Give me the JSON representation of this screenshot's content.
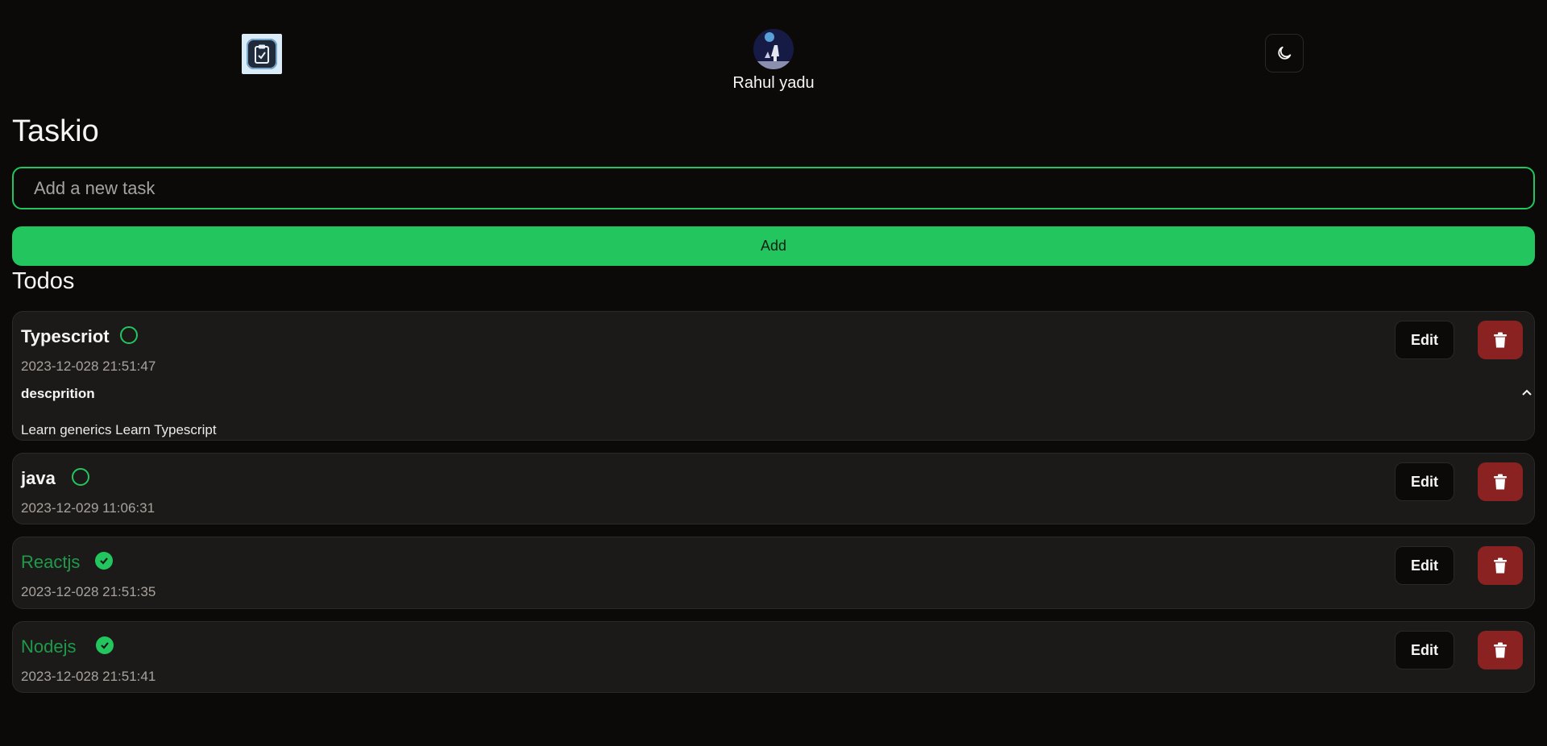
{
  "header": {
    "logo_icon": "clipboard-check-icon",
    "user_name": "Rahul yadu",
    "theme_icon": "moon-icon"
  },
  "app": {
    "title": "Taskio"
  },
  "new_task": {
    "placeholder": "Add a new task",
    "value": ""
  },
  "add_button": {
    "label": "Add"
  },
  "todos_heading": "Todos",
  "todo_labels": {
    "edit": "Edit",
    "delete_icon": "trash-icon"
  },
  "todos": [
    {
      "title": "Typescriot",
      "date": "2023-12-028 21:51:47",
      "completed": false,
      "expanded": true,
      "description_label": "descprition",
      "description": "Learn generics Learn Typescript"
    },
    {
      "title": "java",
      "date": "2023-12-029 11:06:31",
      "completed": false
    },
    {
      "title": "Reactjs",
      "date": "2023-12-028 21:51:35",
      "completed": true
    },
    {
      "title": "Nodejs",
      "date": "2023-12-028 21:51:41",
      "completed": true
    }
  ],
  "colors": {
    "background": "#0b0a09",
    "accent": "#22c55e",
    "card": "#1c1a18",
    "danger": "#8b2222",
    "completed_text": "#1e9a4a"
  }
}
